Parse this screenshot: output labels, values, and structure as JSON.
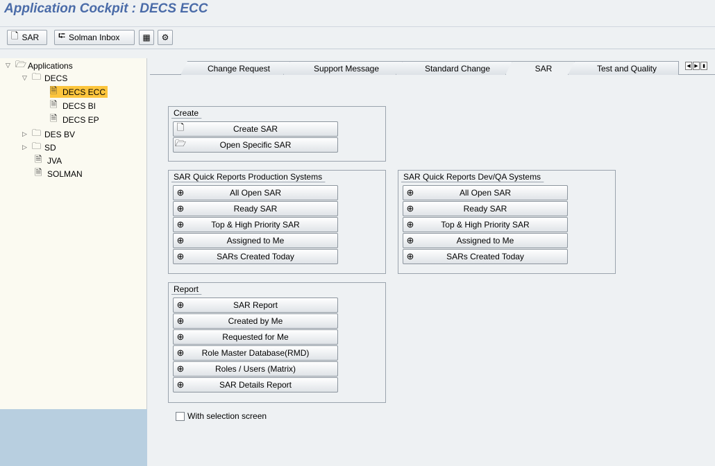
{
  "title": "Application Cockpit : DECS ECC",
  "toolbar": {
    "sar_label": "SAR",
    "inbox_label": "Solman Inbox"
  },
  "tree": {
    "root": "Applications",
    "decs": "DECS",
    "decs_ecc": "DECS ECC",
    "decs_bi": "DECS BI",
    "decs_ep": "DECS EP",
    "des_bv": "DES BV",
    "sd": "SD",
    "jva": "JVA",
    "solman": "SOLMAN"
  },
  "tabs": [
    "Change Request",
    "Support Message",
    "Standard Change",
    "SAR",
    "Test and Quality"
  ],
  "groups": {
    "create": {
      "title": "Create",
      "buttons": [
        "Create SAR",
        "Open Specific SAR"
      ]
    },
    "prod": {
      "title": "SAR Quick Reports Production Systems",
      "buttons": [
        "All Open SAR",
        "Ready SAR",
        "Top & High Priority SAR",
        "Assigned to Me",
        "SARs Created Today"
      ]
    },
    "devqa": {
      "title": "SAR Quick Reports Dev/QA Systems",
      "buttons": [
        "All Open SAR",
        "Ready SAR",
        "Top & High Priority SAR",
        "Assigned to Me",
        "SARs Created Today"
      ]
    },
    "report": {
      "title": "Report",
      "buttons": [
        "SAR Report",
        "Created by Me",
        "Requested for Me",
        "Role Master Database(RMD)",
        "Roles / Users (Matrix)",
        "SAR Details Report"
      ]
    }
  },
  "checkbox": {
    "label": "With selection screen",
    "checked": false
  },
  "colors": {
    "title": "#4a6ba8",
    "selected": "#fcc53d"
  }
}
